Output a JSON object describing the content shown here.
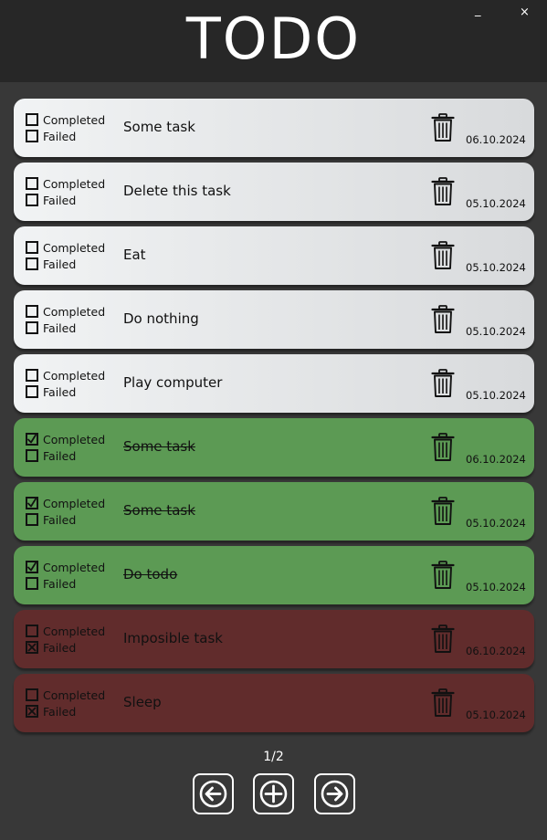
{
  "app": {
    "title": "TODO",
    "minimize_label": "_",
    "close_label": "×"
  },
  "labels": {
    "completed": "Completed",
    "failed": "Failed"
  },
  "tasks": [
    {
      "text": "Some task",
      "date": "06.10.2024",
      "completed": false,
      "failed": false
    },
    {
      "text": "Delete this task",
      "date": "05.10.2024",
      "completed": false,
      "failed": false
    },
    {
      "text": "Eat",
      "date": "05.10.2024",
      "completed": false,
      "failed": false
    },
    {
      "text": "Do nothing",
      "date": "05.10.2024",
      "completed": false,
      "failed": false
    },
    {
      "text": "Play computer",
      "date": "05.10.2024",
      "completed": false,
      "failed": false
    },
    {
      "text": "Some task",
      "date": "06.10.2024",
      "completed": true,
      "failed": false
    },
    {
      "text": "Some task",
      "date": "05.10.2024",
      "completed": true,
      "failed": false
    },
    {
      "text": "Do todo",
      "date": "05.10.2024",
      "completed": true,
      "failed": false
    },
    {
      "text": "Imposible task",
      "date": "06.10.2024",
      "completed": false,
      "failed": true
    },
    {
      "text": "Sleep",
      "date": "05.10.2024",
      "completed": false,
      "failed": true
    }
  ],
  "pagination": {
    "indicator": "1/2",
    "prev_icon": "arrow-left-icon",
    "add_icon": "plus-icon",
    "next_icon": "arrow-right-icon"
  },
  "colors": {
    "background": "#383838",
    "titlebar": "#272727",
    "pending": "#e6e8ea",
    "completed": "#5c9a54",
    "failed": "#612c2c"
  }
}
